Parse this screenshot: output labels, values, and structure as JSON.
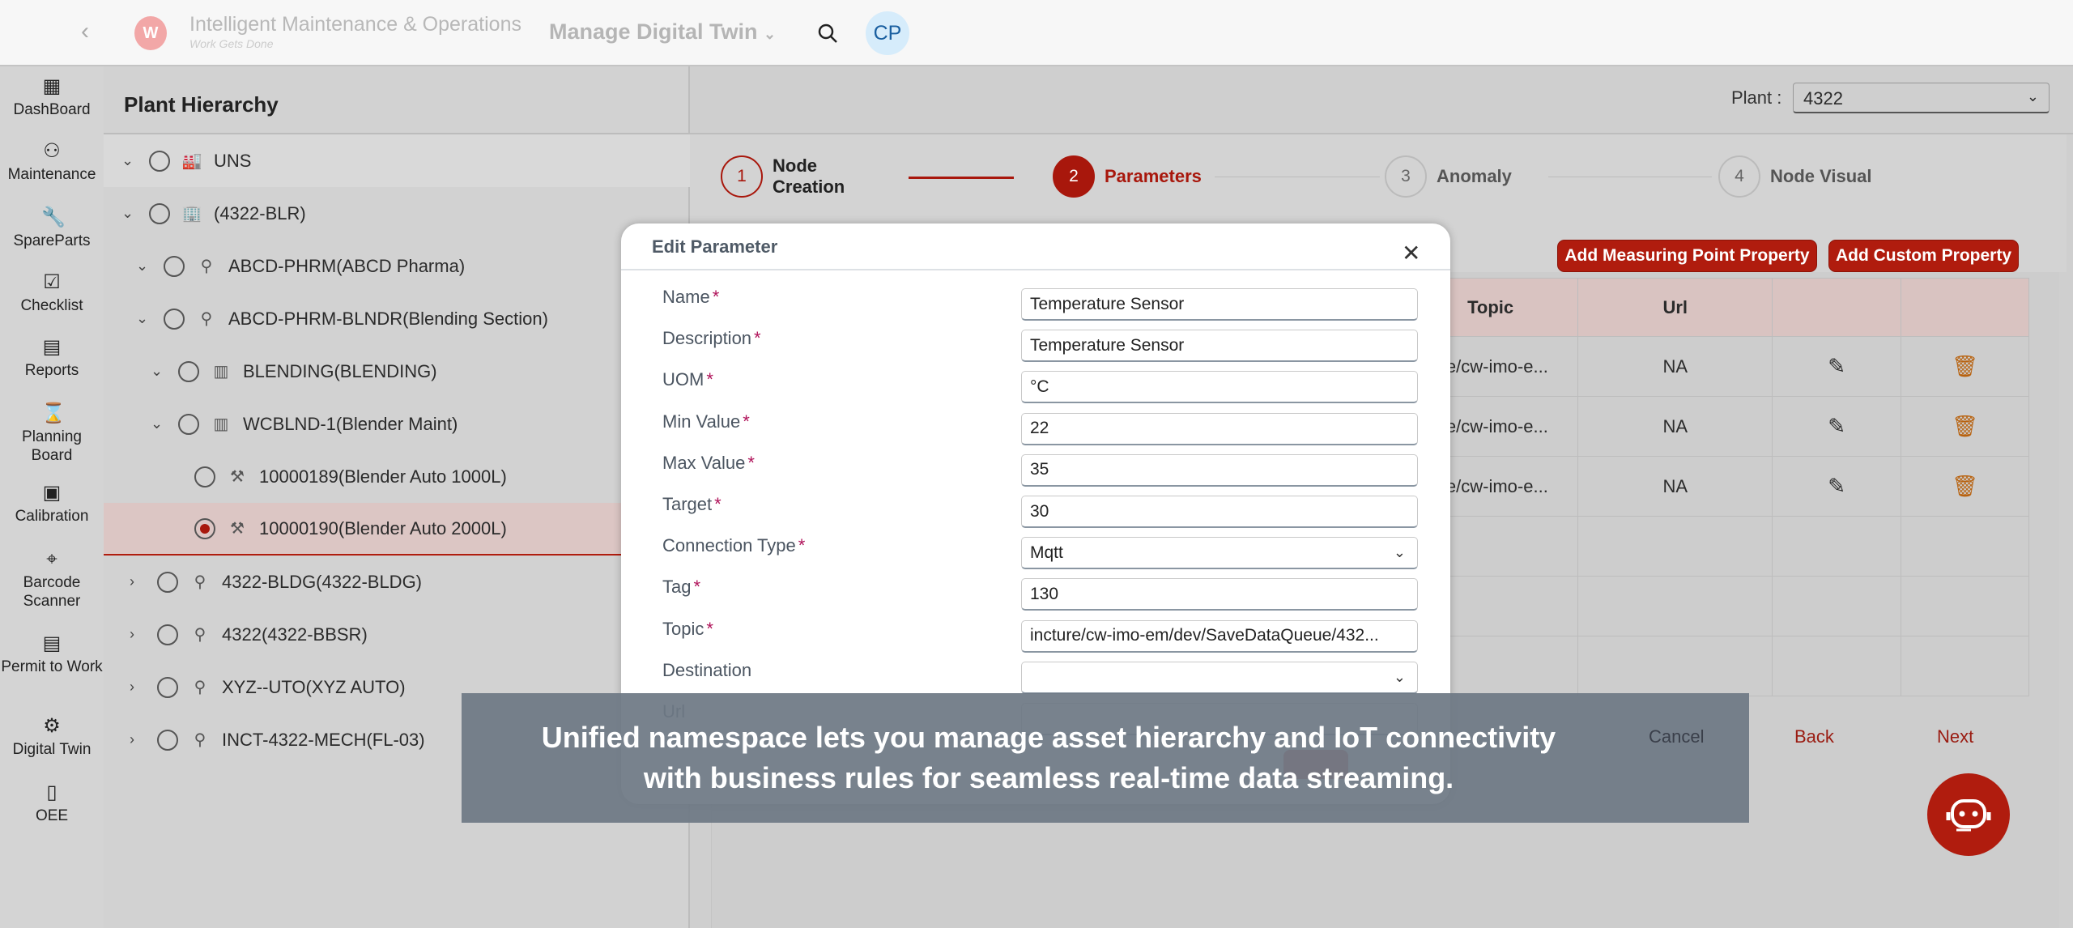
{
  "header": {
    "app_title": "Intelligent Maintenance & Operations",
    "app_subtitle": "Work Gets Done",
    "module": "Manage Digital Twin",
    "avatar": "CP",
    "icons": {
      "back": "chevron-left-icon",
      "logo": "apple-logo",
      "search": "search-icon"
    }
  },
  "sidebar": {
    "items": [
      {
        "label": "DashBoard",
        "icon": "▦"
      },
      {
        "label": "Maintenance",
        "icon": "⚇"
      },
      {
        "label": "SpareParts",
        "icon": "🔧"
      },
      {
        "label": "Checklist",
        "icon": "☑"
      },
      {
        "label": "Reports",
        "icon": "▤"
      },
      {
        "label": "Planning Board",
        "icon": "⌛"
      },
      {
        "label": "Calibration",
        "icon": "▣"
      },
      {
        "label": "Barcode Scanner",
        "icon": "⌖"
      },
      {
        "label": "Permit to Work",
        "icon": "▤"
      },
      {
        "label": "Digital Twin",
        "icon": "⚙"
      },
      {
        "label": "OEE",
        "icon": "▯"
      }
    ]
  },
  "tree": {
    "title": "Plant Hierarchy",
    "rows": [
      {
        "label": "UNS",
        "icon": "factory-icon",
        "expanded": true,
        "selected": false
      },
      {
        "label": "(4322-BLR)",
        "icon": "building-icon",
        "expanded": true,
        "selected": false
      },
      {
        "label": "ABCD-PHRM(ABCD Pharma)",
        "icon": "location-icon",
        "expanded": true,
        "selected": false
      },
      {
        "label": "ABCD-PHRM-BLNDR(Blending Section)",
        "icon": "location-icon",
        "expanded": true,
        "selected": false
      },
      {
        "label": "BLENDING(BLENDING)",
        "icon": "work-center-icon",
        "expanded": true,
        "selected": false
      },
      {
        "label": "WCBLND-1(Blender Maint)",
        "icon": "work-center-icon",
        "expanded": true,
        "selected": false
      },
      {
        "label": "10000189(Blender Auto 1000L)",
        "icon": "equipment-icon",
        "expanded": null,
        "selected": false
      },
      {
        "label": "10000190(Blender Auto 2000L)",
        "icon": "equipment-icon",
        "expanded": null,
        "selected": true
      },
      {
        "label": "4322-BLDG(4322-BLDG)",
        "icon": "location-icon",
        "expanded": false,
        "selected": false
      },
      {
        "label": "4322(4322-BBSR)",
        "icon": "location-icon",
        "expanded": false,
        "selected": false
      },
      {
        "label": "XYZ--UTO(XYZ AUTO)",
        "icon": "location-icon",
        "expanded": false,
        "selected": false
      },
      {
        "label": "INCT-4322-MECH(FL-03)",
        "icon": "location-icon",
        "expanded": false,
        "selected": false
      }
    ]
  },
  "plant": {
    "label": "Plant :",
    "value": "4322"
  },
  "steps": [
    {
      "num": "1",
      "label": "Node Creation",
      "state": "done"
    },
    {
      "num": "2",
      "label": "Parameters",
      "state": "active"
    },
    {
      "num": "3",
      "label": "Anomaly",
      "state": "pending"
    },
    {
      "num": "4",
      "label": "Node Visual",
      "state": "pending"
    }
  ],
  "actions": {
    "add_measuring": "Add Measuring Point Property",
    "add_custom": "Add Custom Property"
  },
  "table": {
    "headers": [
      "Topic",
      "Url",
      "",
      ""
    ],
    "rows": [
      {
        "topic": "ncture/cw-imo-e...",
        "url": "NA"
      },
      {
        "topic": "ncture/cw-imo-e...",
        "url": "NA"
      },
      {
        "topic": "ncture/cw-imo-e...",
        "url": "NA"
      }
    ]
  },
  "footer": {
    "cancel": "Cancel",
    "back": "Back",
    "next": "Next"
  },
  "dialog": {
    "title": "Edit Parameter",
    "fields": [
      {
        "label": "Name",
        "required": true,
        "value": "Temperature Sensor",
        "type": "text"
      },
      {
        "label": "Description",
        "required": true,
        "value": "Temperature Sensor",
        "type": "text"
      },
      {
        "label": "UOM",
        "required": true,
        "value": "°C",
        "type": "text"
      },
      {
        "label": "Min Value",
        "required": true,
        "value": "22",
        "type": "text"
      },
      {
        "label": "Max Value",
        "required": true,
        "value": "35",
        "type": "text"
      },
      {
        "label": "Target",
        "required": true,
        "value": "30",
        "type": "text"
      },
      {
        "label": "Connection Type",
        "required": true,
        "value": "Mqtt",
        "type": "select"
      },
      {
        "label": "Tag",
        "required": true,
        "value": "130",
        "type": "text"
      },
      {
        "label": "Topic",
        "required": true,
        "value": "incture/cw-imo-em/dev/SaveDataQueue/432...",
        "type": "text"
      },
      {
        "label": "Destination",
        "required": false,
        "value": "",
        "type": "select"
      },
      {
        "label": "Url",
        "required": false,
        "value": "",
        "type": "text"
      }
    ]
  },
  "caption": {
    "line1": "Unified namespace lets you manage asset hierarchy and IoT connectivity",
    "line2": "with business rules for seamless real-time data streaming."
  },
  "colors": {
    "accent": "#b01c0e",
    "required": "#b0135a",
    "selected_row": "#dcc6c4"
  }
}
